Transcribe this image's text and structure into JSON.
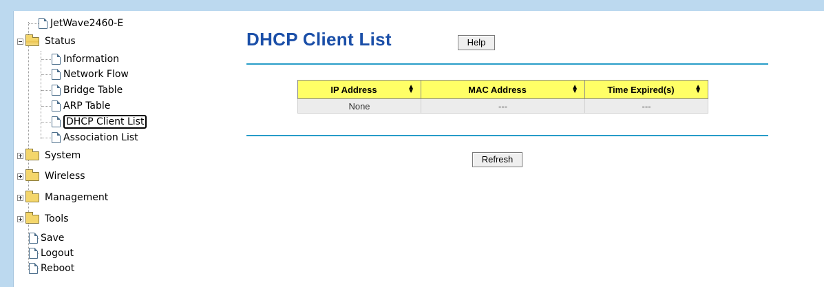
{
  "tree": {
    "root": "JetWave2460-E",
    "status": {
      "label": "Status",
      "items": [
        "Information",
        "Network Flow",
        "Bridge Table",
        "ARP Table",
        "DHCP Client List",
        "Association List"
      ]
    },
    "folders": [
      "System",
      "Wireless",
      "Management",
      "Tools"
    ],
    "actions": [
      "Save",
      "Logout",
      "Reboot"
    ]
  },
  "page": {
    "title": "DHCP Client List",
    "help_label": "Help",
    "refresh_label": "Refresh"
  },
  "table": {
    "headers": [
      "IP Address",
      "MAC Address",
      "Time Expired(s)"
    ],
    "rows": [
      [
        "None",
        "---",
        "---"
      ]
    ]
  },
  "colors": {
    "title": "#1b4fa8",
    "rule": "#279cc8",
    "header_bg": "#ffff66",
    "frame": "#bcd9ef"
  }
}
